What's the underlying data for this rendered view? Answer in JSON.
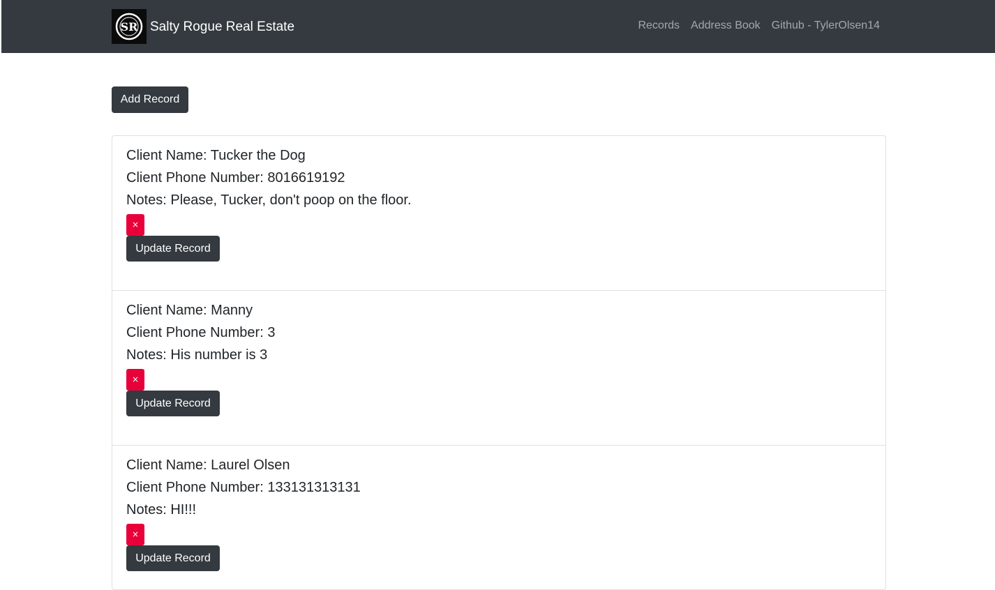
{
  "navbar": {
    "brand": "Salty Rogue Real Estate",
    "logo_icon": "salty-rogue-logo",
    "links": [
      "Records",
      "Address Book",
      "Github - TylerOlsen14"
    ]
  },
  "actions": {
    "add_label": "Add Record"
  },
  "labels": {
    "delete": "×",
    "update": "Update Record"
  },
  "records": [
    {
      "name": "Client Name: Tucker the Dog",
      "phone": "Client Phone Number: 8016619192",
      "notes": "Notes: Please, Tucker, don't poop on the floor."
    },
    {
      "name": "Client Name: Manny",
      "phone": "Client Phone Number: 3",
      "notes": "Notes: His number is 3"
    },
    {
      "name": "Client Name: Laurel Olsen",
      "phone": "Client Phone Number: 133131313131",
      "notes": "Notes: HI!!!"
    }
  ],
  "colors": {
    "navbar": "#343a40",
    "button_dark": "#343a40",
    "delete": "#e8003a"
  }
}
